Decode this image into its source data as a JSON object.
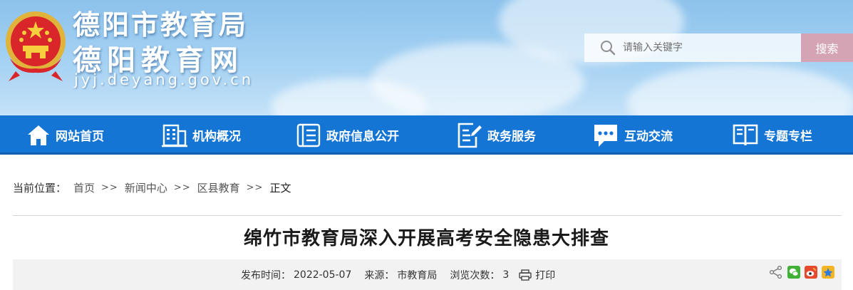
{
  "header": {
    "title_line1": "德阳市教育局",
    "title_line2": "德阳教育网",
    "url": "jyj.deyang.gov.cn",
    "search": {
      "placeholder": "请输入关键字",
      "button_label": "搜索"
    }
  },
  "nav": {
    "items": [
      {
        "label": "网站首页",
        "icon": "home-icon"
      },
      {
        "label": "机构概况",
        "icon": "building-icon"
      },
      {
        "label": "政府信息公开",
        "icon": "document-icon"
      },
      {
        "label": "政务服务",
        "icon": "edit-document-icon"
      },
      {
        "label": "互动交流",
        "icon": "chat-icon"
      },
      {
        "label": "专题专栏",
        "icon": "book-icon"
      }
    ]
  },
  "breadcrumb": {
    "prefix": "当前位置：",
    "items": [
      "首页",
      "新闻中心",
      "区县教育"
    ],
    "separator": ">>",
    "current": "正文"
  },
  "article": {
    "title": "绵竹市教育局深入开展高考安全隐患大排查",
    "publish_label": "发布时间：",
    "publish_date": "2022-05-07",
    "source_label": "来源：",
    "source": "市教育局",
    "views_label": "浏览次数：",
    "views": "3",
    "print_label": "打印"
  },
  "share": {
    "icons": [
      "share-icon",
      "wechat-icon",
      "weibo-icon",
      "qzone-icon"
    ]
  },
  "colors": {
    "nav_blue": "#1475d4",
    "search_button": "#d5a4b4",
    "banner_sky": "#a6d2f3",
    "meta_bar": "#f2f2f2"
  }
}
